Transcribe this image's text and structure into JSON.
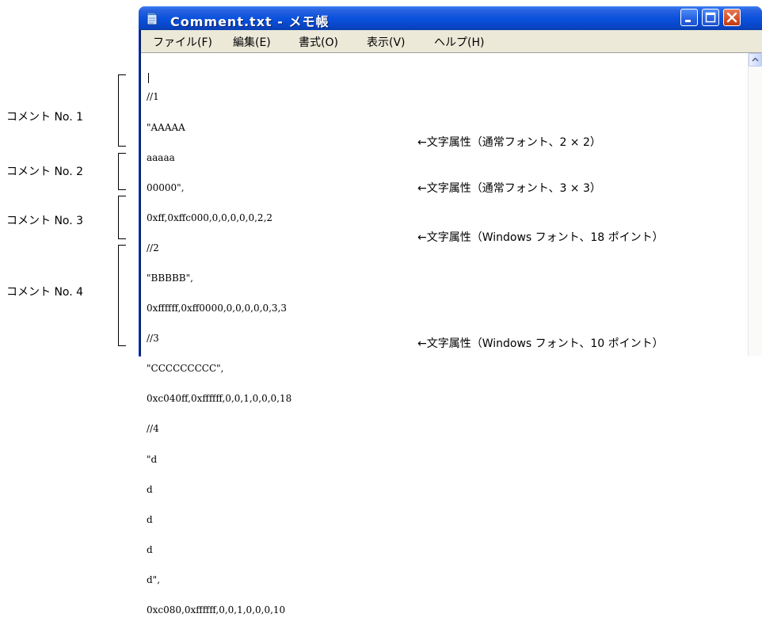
{
  "window": {
    "title": "Comment.txt - メモ帳",
    "menu": [
      "ファイル(F)",
      "編集(E)",
      "書式(O)",
      "表示(V)",
      "ヘルプ(H)"
    ]
  },
  "editor_lines": [
    "//1",
    "\"AAAAA",
    "aaaaa",
    "00000\",",
    "0xff,0xffc000,0,0,0,0,0,2,2",
    "//2",
    "\"BBBBB\",",
    "0xffffff,0xff0000,0,0,0,0,0,3,3",
    "//3",
    "\"CCCCCCCCC\",",
    "0xc040ff,0xffffff,0,0,1,0,0,0,18",
    "//4",
    "\"d",
    "d",
    "d",
    "d",
    "d\",",
    "0xc080,0xffffff,0,0,1,0,0,0,10"
  ],
  "annotations": [
    "←文字属性（通常フォント、2 × 2）",
    "←文字属性（通常フォント、3 × 3）",
    "←文字属性（Windows フォント、18 ポイント）",
    "←文字属性（Windows フォント、10 ポイント）"
  ],
  "labels": [
    "コメント No. 1",
    "コメント No. 2",
    "コメント No. 3",
    "コメント No. 4"
  ],
  "colors": {
    "titlebar": "#0a52dd",
    "menubar": "#ece9d8",
    "close_button": "#d64d24"
  },
  "icons": [
    "notepad-icon",
    "minimize-icon",
    "maximize-icon",
    "close-icon",
    "scroll-up-arrow-icon"
  ]
}
